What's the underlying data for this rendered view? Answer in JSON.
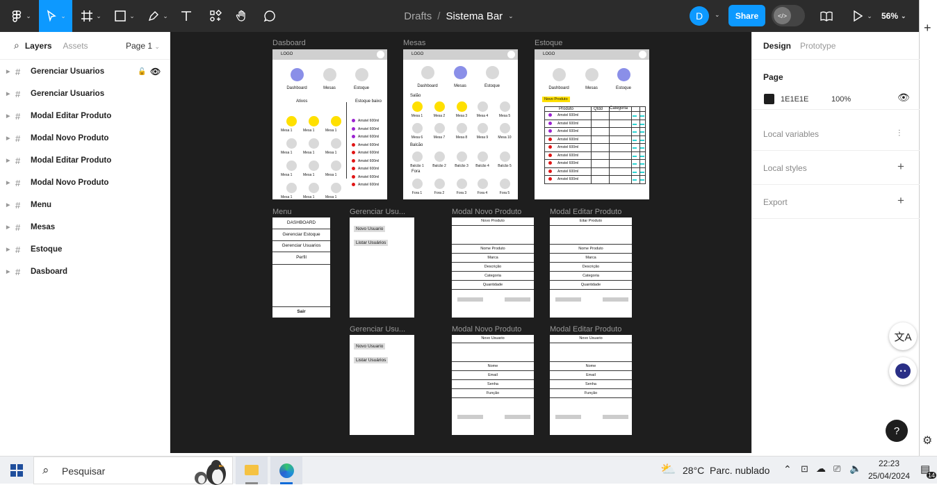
{
  "toolbar": {
    "breadcrumb_drafts": "Drafts",
    "breadcrumb_sep": "/",
    "file_name": "Sistema Bar",
    "avatar_letter": "D",
    "share_label": "Share",
    "zoom_label": "56%"
  },
  "left_panel": {
    "tab_layers": "Layers",
    "tab_assets": "Assets",
    "page_selector": "Page 1",
    "layers": [
      "Gerenciar Usuarios",
      "Gerenciar Usuarios",
      "Modal Editar Produto",
      "Modal Novo Produto",
      "Modal Editar Produto",
      "Modal Novo Produto",
      "Menu",
      "Mesas",
      "Estoque",
      "Dasboard"
    ]
  },
  "right_panel": {
    "tab_design": "Design",
    "tab_prototype": "Prototype",
    "page_heading": "Page",
    "page_color_hex": "1E1E1E",
    "page_opacity": "100%",
    "local_variables": "Local variables",
    "local_styles": "Local styles",
    "export": "Export"
  },
  "canvas": {
    "frame_titles": {
      "dasboard": "Dasboard",
      "mesas": "Mesas",
      "estoque": "Estoque",
      "menu": "Menu",
      "ger1": "Gerenciar Usu...",
      "mnp1": "Modal Novo Produto",
      "mep1": "Modal Editar Produto",
      "ger2": "Gerenciar Usu...",
      "mnp2": "Modal Novo Produto",
      "mep2": "Modal Editar Produto"
    },
    "common": {
      "logo": "LOGO",
      "nav_dashboard": "Dashboard",
      "nav_mesas": "Mesas",
      "nav_estoque": "Estoque"
    },
    "dashboard": {
      "ativos": "Ativos",
      "estoque_baixo": "Estoque baixo",
      "mesa": "Mesa 1",
      "item": "Amstel 600ml"
    },
    "mesas": {
      "salao": "Salão",
      "balcao": "Balcão",
      "fora": "Fora",
      "row1": [
        "Mesa 1",
        "Mesa 2",
        "Mesa 3",
        "Mesa 4",
        "Mesa 5"
      ],
      "row2": [
        "Mesa 6",
        "Mesa 7",
        "Mesa 8",
        "Mesa 9",
        "Mesa 10"
      ],
      "row3": [
        "Balcão 1",
        "Balcão 2",
        "Balcão 3",
        "Balcão 4",
        "Balcão 5"
      ],
      "row4": [
        "Fora 1",
        "Fora 2",
        "Fora 3",
        "Fora 4",
        "Fora 5"
      ]
    },
    "estoque": {
      "novo_produto": "Novo Produto",
      "col_produto": "Produto",
      "col_qtdd": "Qtdd",
      "col_categoria": "Categoria",
      "item": "Amstel 600ml"
    },
    "menu": {
      "items": [
        "DASHBOARD",
        "Gerenciar Estoque",
        "Gerenciar Usuarios",
        "Perfil"
      ],
      "sair": "Sair"
    },
    "gerenciar": {
      "novo_usuario": "Novo Usuario",
      "listar_usuarios": "Listar Usuários"
    },
    "modal_produto": {
      "title_novo": "Novo Produto",
      "title_editar": "Eitar Produto",
      "fields": [
        "Nome Produto",
        "Marca",
        "Descrição",
        "Categoria",
        "Quantidade"
      ]
    },
    "modal_usuario": {
      "title": "Novo Usuario",
      "fields": [
        "Nome",
        "Email",
        "Senha",
        "Função"
      ]
    }
  },
  "taskbar": {
    "search_placeholder": "Pesquisar",
    "weather_temp": "28°C",
    "weather_desc": "Parc. nublado",
    "time": "22:23",
    "date": "25/04/2024",
    "notif_count": "14"
  },
  "colors": {
    "accent": "#0d99ff",
    "canvas_bg": "#1e1e1e",
    "toolbar_bg": "#2c2c2c",
    "active_purple": "#8a8fe8",
    "active_yellow": "#ffe000",
    "status_purple": "#9b23d0",
    "status_red": "#e01515"
  }
}
